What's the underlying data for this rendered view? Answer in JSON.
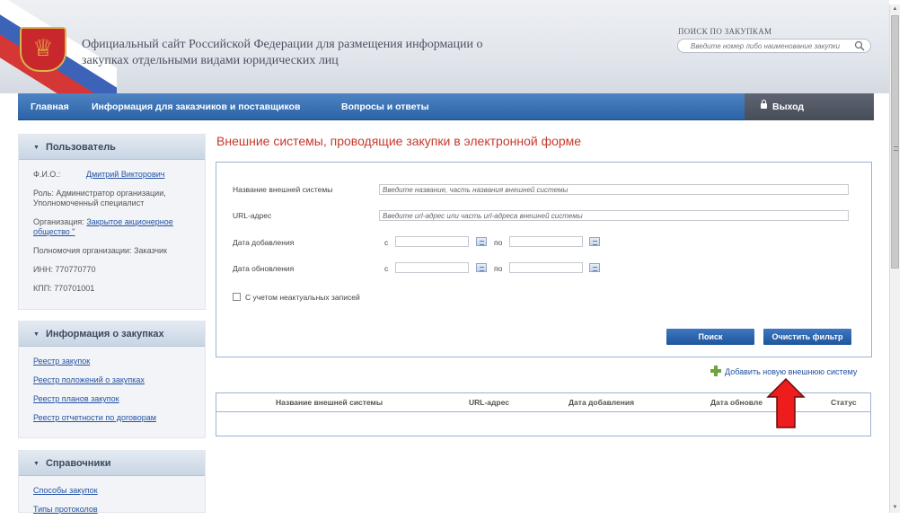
{
  "header": {
    "site_title": "Официальный сайт Российской Федерации для размещения информации о закупках отдельными видами юридических лиц",
    "search_label": "ПОИСК ПО ЗАКУПКАМ",
    "search_placeholder": "Введите номер либо наименование закупки"
  },
  "nav": {
    "items": [
      "Главная",
      "Информация для заказчиков и поставщиков",
      "Вопросы и ответы"
    ],
    "logout": "Выход"
  },
  "sidebar": {
    "user_panel": {
      "title": "Пользователь",
      "fio_label": "Ф.И.О.:",
      "fio_value": "Дмитрий Викторович",
      "role": "Роль: Администратор организации, Уполномоченный специалист",
      "org_label": "Организация:",
      "org_value": "Закрытое акционерное общество \"",
      "authority": "Полномочия организации: Заказчик",
      "inn": "ИНН: 770770770",
      "kpp": "КПП: 770701001"
    },
    "purchases_panel": {
      "title": "Информация о закупках",
      "links": [
        "Реестр закупок",
        "Реестр положений о закупках",
        "Реестр планов закупок",
        "Реестр отчетности по договорам"
      ]
    },
    "reference_panel": {
      "title": "Справочники",
      "links": [
        "Способы закупок",
        "Типы протоколов"
      ]
    }
  },
  "main": {
    "title": "Внешние системы, проводящие закупки в электронной форме",
    "filter": {
      "name_label": "Название внешней системы",
      "name_placeholder": "Введите название, часть названия внешней системы",
      "url_label": "URL-адрес",
      "url_placeholder": "Введите url-адрес или часть url-адреса внешней системы",
      "added_label": "Дата добавления",
      "updated_label": "Дата обновления",
      "from": "с",
      "to": "по",
      "checkbox_label": "С учетом неактуальных записей",
      "search_button": "Поиск",
      "clear_button": "Очистить фильтр"
    },
    "add_link": "Добавить новую внешнюю систему",
    "table": {
      "columns": [
        "Название внешней системы",
        "URL-адрес",
        "Дата добавления",
        "Дата обновле",
        "Статус"
      ]
    }
  },
  "colors": {
    "accent_red": "#c6392c",
    "nav_blue": "#2c63a7",
    "link_blue": "#2452a3",
    "arrow_red": "#ee1c1c"
  }
}
